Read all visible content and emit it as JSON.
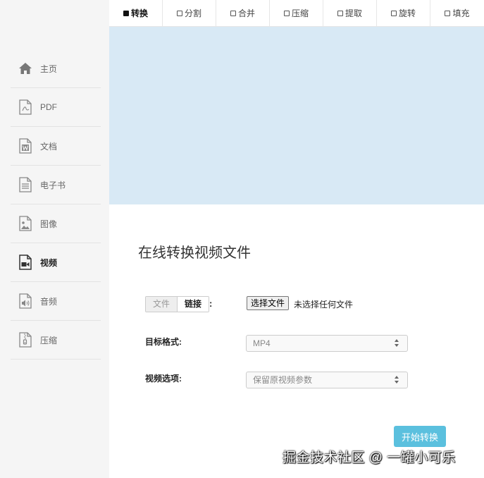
{
  "sidebar": {
    "items": [
      {
        "label": "主页",
        "icon": "home-icon",
        "active": false
      },
      {
        "label": "PDF",
        "icon": "pdf-file-icon",
        "active": false
      },
      {
        "label": "文档",
        "icon": "word-document-icon",
        "active": false
      },
      {
        "label": "电子书",
        "icon": "ebook-icon",
        "active": false
      },
      {
        "label": "图像",
        "icon": "image-file-icon",
        "active": false
      },
      {
        "label": "视频",
        "icon": "video-file-icon",
        "active": true
      },
      {
        "label": "音频",
        "icon": "audio-file-icon",
        "active": false
      },
      {
        "label": "压缩",
        "icon": "zip-file-icon",
        "active": false
      }
    ]
  },
  "tabs": [
    {
      "label": "转换",
      "active": true
    },
    {
      "label": "分割",
      "active": false
    },
    {
      "label": "合并",
      "active": false
    },
    {
      "label": "压缩",
      "active": false
    },
    {
      "label": "提取",
      "active": false
    },
    {
      "label": "旋转",
      "active": false
    },
    {
      "label": "填充",
      "active": false
    }
  ],
  "main": {
    "title": "在线转换视频文件",
    "source": {
      "file_tab": "文件",
      "link_tab": "链接",
      "colon": ":",
      "choose_button": "选择文件",
      "no_file_text": "未选择任何文件"
    },
    "target_format": {
      "label": "目标格式:",
      "value": "MP4"
    },
    "video_options": {
      "label": "视频选项:",
      "value": "保留原视频参数"
    },
    "start_button": "开始转换"
  },
  "watermark": "掘金技术社区 @ 一罐小可乐",
  "colors": {
    "banner": "#d8e9f5",
    "sidebar_bg": "#f5f5f5",
    "start_button": "#5bc0de"
  }
}
